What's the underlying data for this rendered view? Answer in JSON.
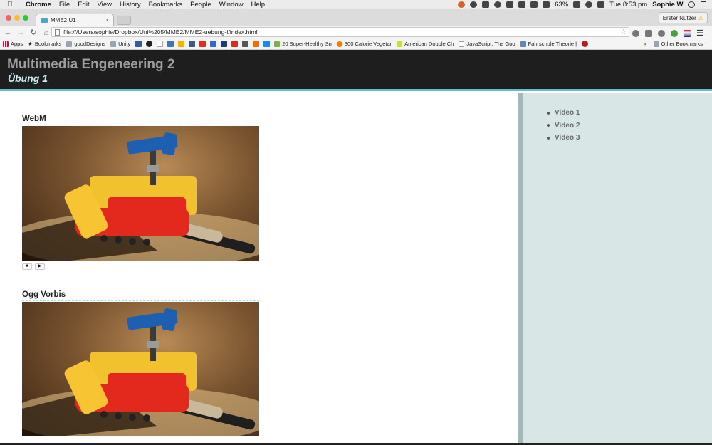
{
  "menubar": {
    "app_name": "Chrome",
    "menus": [
      "File",
      "Edit",
      "View",
      "History",
      "Bookmarks",
      "People",
      "Window",
      "Help"
    ],
    "battery": "63%",
    "clock": "Tue 8:53 pm",
    "user": "Sophie W"
  },
  "browser": {
    "tab_title": "MME2 U1",
    "tab_close": "×",
    "profile_label": "Erster Nutzer",
    "url": "file:///Users/sophie/Dropbox/Uni%205/MME2/MME2-uebung-I/index.html",
    "bookmarks": {
      "apps": "Apps",
      "bookmarks": "Bookmarks",
      "good_designs": "goodDesigns",
      "unity": "Unity",
      "healthy": "20 Super-Healthy Sn",
      "calorie": "300 Calorie Vegetar",
      "american": "American Double Ch",
      "javascript": "JavaScript: The Goo",
      "fahrschule": "Fahrschule Theorie |",
      "other": "Other Bookmarks",
      "overflow": "»"
    }
  },
  "site": {
    "title": "Multimedia Engeneering 2",
    "subtitle": "Übung 1"
  },
  "videos": [
    {
      "heading": "WebM",
      "stop_glyph": "■",
      "play_glyph": "▶"
    },
    {
      "heading": "Ogg Vorbis"
    }
  ],
  "sidebar": {
    "items": [
      "Video 1",
      "Video 2",
      "Video 3"
    ]
  },
  "colors": {
    "header_bg": "#1e1e1e",
    "header_accent": "#5fbfc9",
    "sidebar_bg": "#d9e6e6"
  }
}
